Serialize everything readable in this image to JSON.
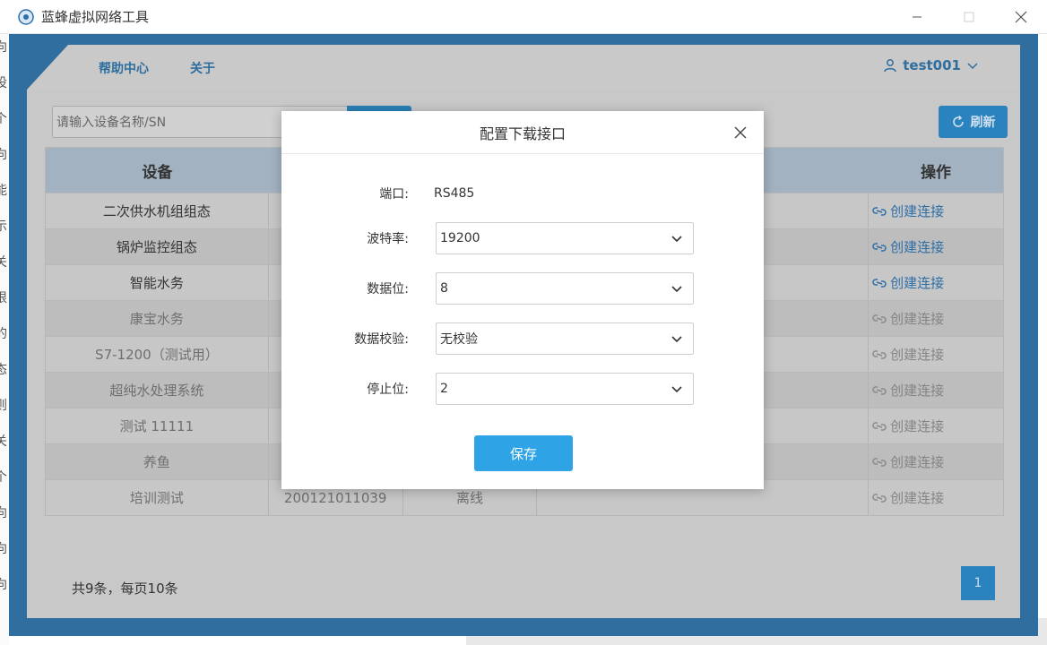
{
  "window": {
    "title": "蓝蜂虚拟网络工具",
    "minimize": "—",
    "maximize": "☐",
    "close": "✕"
  },
  "background_left_chars": [
    "向",
    "设",
    "个",
    "向",
    "能",
    "示",
    "关",
    "根",
    "的",
    "态",
    "则",
    "关",
    "个",
    "向",
    "向",
    "向"
  ],
  "nav": {
    "help": "帮助中心",
    "about": "关于",
    "user": "test001"
  },
  "search": {
    "placeholder": "请输入设备名称/SN"
  },
  "refresh_label": "刷新",
  "table": {
    "headers": [
      "设备",
      "",
      "",
      "",
      "操作"
    ],
    "rows": [
      {
        "name": "二次供水机组组态",
        "sn": "",
        "status": "",
        "action": "创建连接",
        "active": true
      },
      {
        "name": "锅炉监控组态",
        "sn": "",
        "status": "",
        "action": "创建连接",
        "active": true
      },
      {
        "name": "智能水务",
        "sn": "",
        "status": "",
        "action": "创建连接",
        "active": true
      },
      {
        "name": "康宝水务",
        "sn": "",
        "status": "",
        "action": "创建连接",
        "active": false
      },
      {
        "name": "S7-1200（测试用）",
        "sn": "",
        "status": "",
        "action": "创建连接",
        "active": false
      },
      {
        "name": "超纯水处理系统",
        "sn": "",
        "status": "",
        "action": "创建连接",
        "active": false
      },
      {
        "name": "测试 11111",
        "sn": "",
        "status": "",
        "action": "创建连接",
        "active": false
      },
      {
        "name": "养鱼",
        "sn": "",
        "status": "",
        "action": "创建连接",
        "active": false
      },
      {
        "name": "培训测试",
        "sn": "200121011039",
        "status": "离线",
        "action": "创建连接",
        "active": false
      }
    ]
  },
  "pager": {
    "summary": "共9条，每页10条",
    "current": "1"
  },
  "modal": {
    "title": "配置下载接口",
    "port_label": "端口:",
    "port_value": "RS485",
    "baud_label": "波特率:",
    "baud_value": "19200",
    "databits_label": "数据位:",
    "databits_value": "8",
    "parity_label": "数据校验:",
    "parity_value": "无校验",
    "stopbits_label": "停止位:",
    "stopbits_value": "2",
    "save_label": "保存"
  },
  "colors": {
    "frame": "#2f6e9e",
    "accent": "#2ea3e6",
    "link": "#2f6ea6"
  }
}
